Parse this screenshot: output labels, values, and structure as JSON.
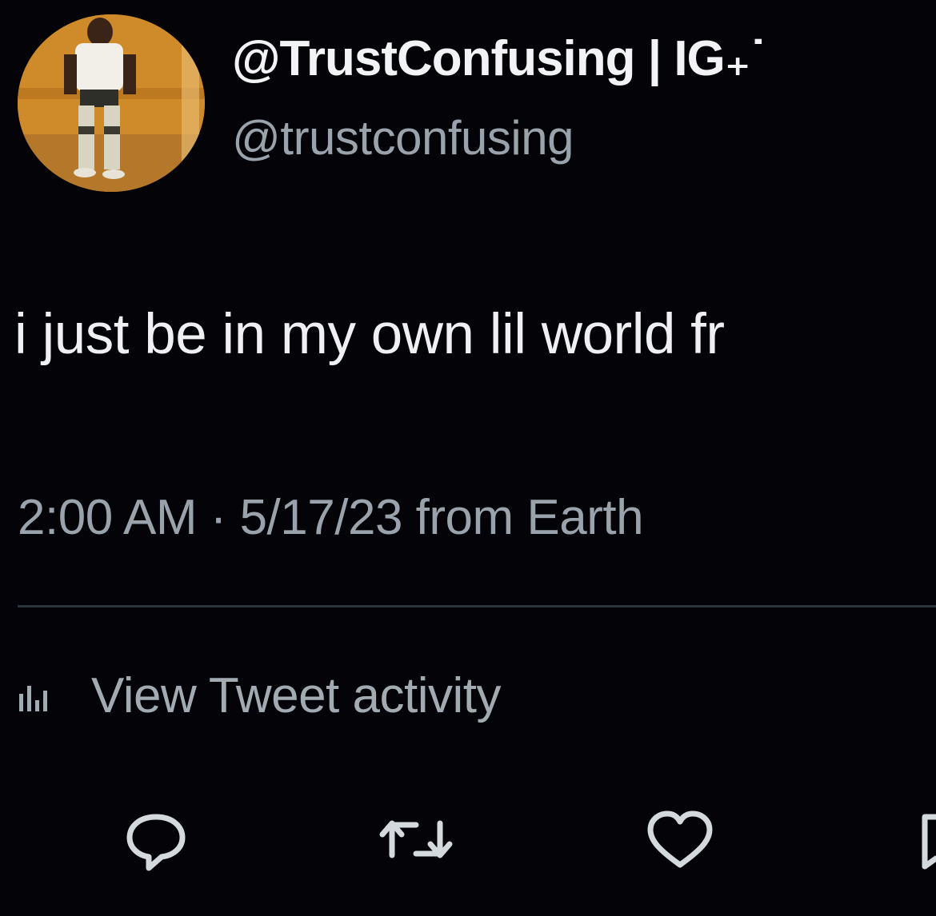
{
  "tweet": {
    "display_name": "@TrustConfusing | IG₊˙",
    "handle": "@trustconfusing",
    "text": "i just be in my own lil world fr",
    "meta": "2:00 AM · 5/17/23 from Earth",
    "activity_label": "View Tweet activity"
  },
  "icons": {
    "activity": "bar-chart-icon",
    "reply": "speech-bubble-icon",
    "retweet": "retweet-arrows-icon",
    "like": "heart-icon",
    "bookmark": "bookmark-icon"
  },
  "colors": {
    "background": "#030308",
    "primary_text": "#eef0f2",
    "secondary_text": "#9aa3ab",
    "divider": "#2c343b"
  }
}
